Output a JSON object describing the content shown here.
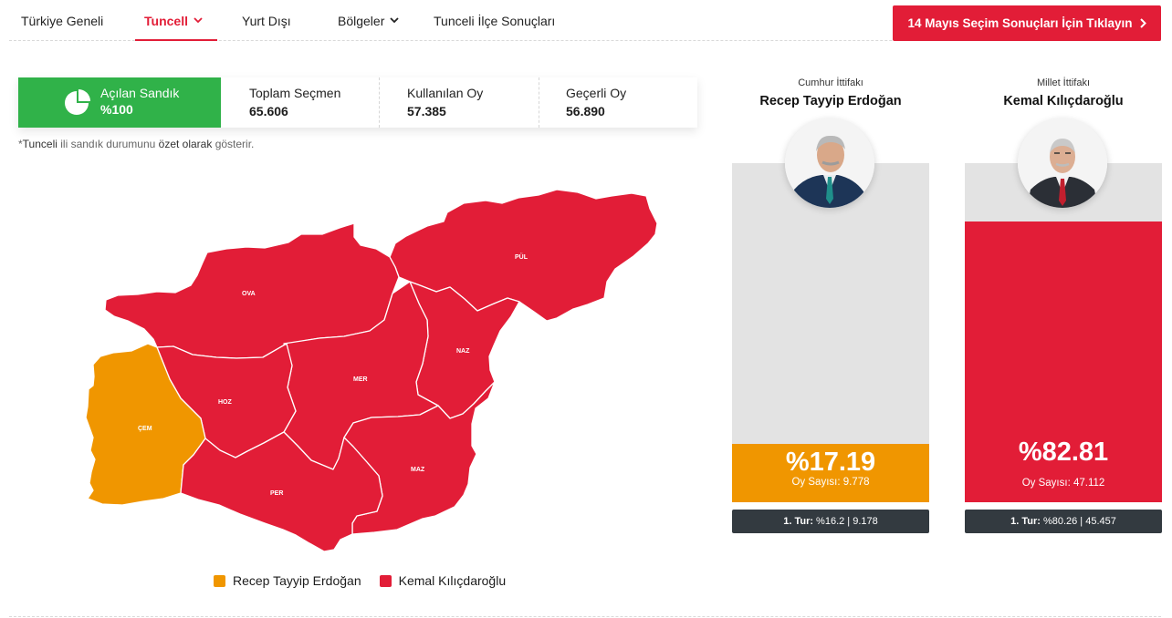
{
  "nav": {
    "items": [
      {
        "label": "Türkiye Geneli"
      },
      {
        "label": "Tuncell"
      },
      {
        "label": "Yurt Dışı"
      },
      {
        "label": "Bölgeler"
      },
      {
        "label": "Tunceli İlçe Sonuçları"
      }
    ],
    "cta_label": "14 Mayıs Seçim Sonuçları İçin Tıklayın"
  },
  "stats": {
    "opened_label": "Açılan Sandık",
    "opened_value": "%100",
    "total_voters_label": "Toplam Seçmen",
    "total_voters_value": "65.606",
    "votes_cast_label": "Kullanılan Oy",
    "votes_cast_value": "57.385",
    "valid_votes_label": "Geçerli Oy",
    "valid_votes_value": "56.890"
  },
  "note": {
    "star": "*",
    "province": "Tunceli",
    "text1": " ili sandık durumunu ",
    "bold": "özet olarak",
    "text2": " gösterir."
  },
  "map": {
    "districts": [
      {
        "label": "PÜL",
        "winner": "kk"
      },
      {
        "label": "OVA",
        "winner": "kk"
      },
      {
        "label": "NAZ",
        "winner": "kk"
      },
      {
        "label": "MER",
        "winner": "kk"
      },
      {
        "label": "HOZ",
        "winner": "kk"
      },
      {
        "label": "ÇEM",
        "winner": "rte"
      },
      {
        "label": "MAZ",
        "winner": "kk"
      },
      {
        "label": "PER",
        "winner": "kk"
      }
    ]
  },
  "legend": [
    {
      "label": "Recep Tayyip Erdoğan",
      "color": "#f09600"
    },
    {
      "label": "Kemal Kılıçdaroğlu",
      "color": "#e21d37"
    }
  ],
  "candidates": [
    {
      "alliance": "Cumhur İttifakı",
      "name": "Recep Tayyip Erdoğan",
      "percent_label": "%17.19",
      "percent": 17.19,
      "count_label": "Oy Sayısı: 9.778",
      "round1_label": "1. Tur:",
      "round1_value": "%16.2 | 9.178",
      "color": "#f09600"
    },
    {
      "alliance": "Millet İttifakı",
      "name": "Kemal Kılıçdaroğlu",
      "percent_label": "%82.81",
      "percent": 82.81,
      "count_label": "Oy Sayısı: 47.112",
      "round1_label": "1. Tur:",
      "round1_value": "%80.26 | 45.457",
      "color": "#e21d37"
    }
  ],
  "colors": {
    "accent_red": "#e21d37",
    "erdogan_orange": "#f09600",
    "green": "#30b249",
    "dark": "#333a40"
  }
}
